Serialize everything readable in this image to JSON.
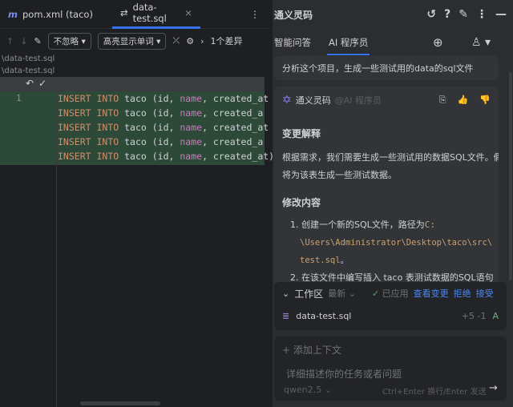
{
  "editor": {
    "tabs": [
      {
        "label": "pom.xml (taco)",
        "icon": "maven-icon"
      },
      {
        "label": "data-test.sql",
        "icon": "diff-icon",
        "active": true
      }
    ],
    "toolbar": {
      "ignore": "不忽略",
      "highlight": "高亮显示单词",
      "diff_count": "1个差异"
    },
    "paths": [
      "\\data-test.sql",
      "\\data-test.sql"
    ],
    "line_number": "1",
    "lines": [
      {
        "kw1": "INSERT",
        "kw2": "INTO",
        "rest": "taco (id, ",
        "c1": "name",
        "c2": ", created_at"
      },
      {
        "kw1": "INSERT",
        "kw2": "INTO",
        "rest": "taco (id, ",
        "c1": "name",
        "c2": ", created_a"
      },
      {
        "kw1": "INSERT",
        "kw2": "INTO",
        "rest": "taco (id, ",
        "c1": "name",
        "c2": ", created_at"
      },
      {
        "kw1": "INSERT",
        "kw2": "INTO",
        "rest": "taco (id, ",
        "c1": "name",
        "c2": ", created_a"
      },
      {
        "kw1": "INSERT",
        "kw2": "INTO",
        "rest": "taco (id, ",
        "c1": "name",
        "c2": ", created_at)"
      }
    ]
  },
  "panel": {
    "title": "通义灵码",
    "tabs": [
      "智能问答",
      "AI 程序员"
    ],
    "user_message": "分析这个项目，生成一些测试用的data的sql文件",
    "reply": {
      "author": "通义灵码",
      "role": "@AI 程序员",
      "h1": "变更解释",
      "p1": "根据需求，我们需要生成一些测试用的数据SQL文件。假设",
      "p1b": "将为该表生成一些测试数据。",
      "h2": "修改内容",
      "item1": "创建一个新的SQL文件，路径为",
      "item1_code_a": "C:",
      "item1_code_b": "\\Users\\Administrator\\Desktop\\taco\\src\\",
      "item1_code_c": "test.sql",
      "item2": "在该文件中编写插入 taco 表测试数据的SQL语句"
    },
    "workspace": {
      "label": "工作区",
      "version": "最新",
      "applied": "已应用",
      "view": "查看变更",
      "reject": "拒绝",
      "accept": "接受",
      "file": "data-test.sql",
      "added": "+5",
      "removed": "-1",
      "status": "A"
    },
    "input": {
      "add_context": "添加上下文",
      "placeholder": "详细描述你的任务或者问题",
      "model": "qwen2.5",
      "hint": "Ctrl+Enter 换行/Enter 发送"
    }
  }
}
